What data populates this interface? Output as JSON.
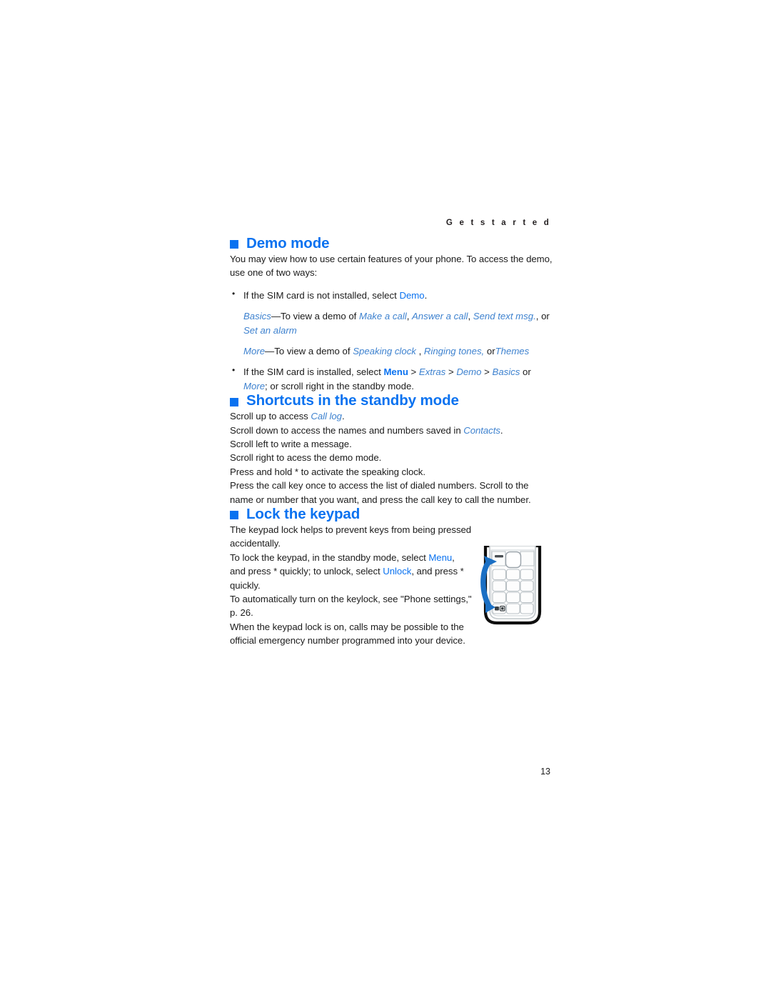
{
  "header": {
    "running_head": "G e t   s t a r t e d"
  },
  "sections": {
    "demo": {
      "heading": "Demo mode",
      "intro": "You may view how to use certain features of your phone. To access the demo, use one of two ways:",
      "bullet1": {
        "lead": "If the SIM card is not installed, select ",
        "link": "Demo",
        "tail": "."
      },
      "basics_line": {
        "label": "Basics",
        "dash_text": "—To view a demo of ",
        "item1": "Make a call",
        "sep1": ", ",
        "item2": "Answer a call",
        "sep2": ", ",
        "item3": "Send text msg.",
        "sep3": ", ",
        "or": "or ",
        "item4": "Set an alarm"
      },
      "more_line": {
        "label": "More",
        "dash_text": "—To view a demo of ",
        "item1": "Speaking clock ",
        "sep1": ", ",
        "item2": "Ringing tones,",
        "or": " or",
        "item3": "Themes"
      },
      "bullet2": {
        "lead": "If the SIM card is installed, select ",
        "menu": "Menu",
        "gt1": " > ",
        "extras": "Extras",
        "gt2": " > ",
        "demo": "Demo",
        "gt3": " > ",
        "basics": "Basics",
        "or": " or ",
        "more": "More",
        "tail": "; or scroll right in the standby mode."
      }
    },
    "shortcuts": {
      "heading": "Shortcuts in the standby mode",
      "lines": [
        {
          "pre": "Scroll up to access ",
          "em": "Call log",
          "post": "."
        },
        {
          "pre": "Scroll down to access the names and numbers saved in ",
          "em": "Contacts",
          "post": "."
        },
        {
          "pre": "Scroll left to write a message.",
          "em": "",
          "post": ""
        },
        {
          "pre": "Scroll right to acess the demo mode.",
          "em": "",
          "post": ""
        },
        {
          "pre": "Press and hold * to activate the speaking clock.",
          "em": "",
          "post": ""
        },
        {
          "pre": "Press the call key once to access the list of dialed numbers. Scroll to the name or number that you want, and press the call key to call the number.",
          "em": "",
          "post": ""
        }
      ]
    },
    "lock": {
      "heading": "Lock the keypad",
      "para1": "The keypad lock helps to prevent keys from being pressed accidentally.",
      "para2": {
        "pre": "To lock the keypad, in the standby mode, select ",
        "menu": "Menu",
        "mid": ", and press * quickly; to unlock, select ",
        "unlock": "Unlock",
        "post": ", and press * quickly."
      },
      "para3": "To automatically turn on the keylock, see \"Phone settings,\" p. 26.",
      "para4": "When the keypad lock is on, calls may be possible to the official emergency number programmed into your device."
    }
  },
  "figure": {
    "name": "phone-keypad-illustration",
    "arrow_color": "#1a6fc4"
  },
  "folio": {
    "page_number": "13"
  },
  "colors": {
    "heading_blue": "#0a72f0",
    "italic_blue": "#3e82cf",
    "body_text": "#1b1b1b"
  }
}
